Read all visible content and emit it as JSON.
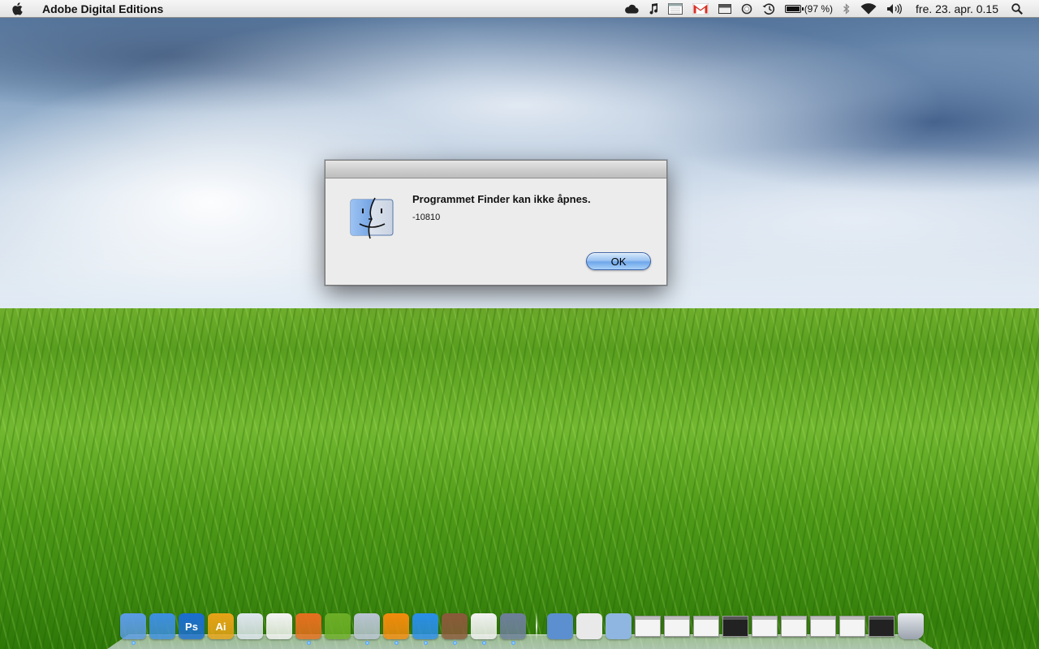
{
  "menubar": {
    "app_name": "Adobe Digital Editions",
    "battery_label": "(97 %)",
    "battery_level_percent": 97,
    "clock": "fre. 23. apr.  0.15",
    "status_icons": [
      "cloud-icon",
      "music-note-icon",
      "calendar-icon",
      "gmail-icon",
      "menu-extra-icon",
      "sync-icon",
      "time-machine-icon",
      "battery-icon",
      "bluetooth-icon",
      "wifi-icon",
      "volume-icon",
      "spotlight-icon"
    ]
  },
  "dialog": {
    "title": "Programmet Finder kan ikke åpnes.",
    "message": "-10810",
    "ok_label": "OK",
    "icon": "finder-icon"
  },
  "dock": {
    "apps": [
      {
        "name": "finder",
        "icon": "finder-icon",
        "color": "#5b9be6",
        "label": "",
        "running": true
      },
      {
        "name": "safari",
        "icon": "safari-icon",
        "color": "#3d8fe0",
        "label": "",
        "running": false
      },
      {
        "name": "photoshop",
        "icon": "photoshop-icon",
        "color": "#1b6ed0",
        "label": "Ps",
        "running": false
      },
      {
        "name": "illustrator",
        "icon": "illustrator-icon",
        "color": "#e8a317",
        "label": "Ai",
        "running": false
      },
      {
        "name": "ical",
        "icon": "calendar-icon",
        "color": "#dfe6ef",
        "label": "",
        "running": false
      },
      {
        "name": "gmail",
        "icon": "gmail-icon",
        "color": "#f4f4f4",
        "label": "",
        "running": false
      },
      {
        "name": "firefox",
        "icon": "firefox-icon",
        "color": "#e66f1e",
        "label": "",
        "running": true
      },
      {
        "name": "spotify",
        "icon": "spotify-icon",
        "color": "#6cae26",
        "label": "",
        "running": false
      },
      {
        "name": "itunes",
        "icon": "itunes-icon",
        "color": "#b9c4d2",
        "label": "",
        "running": true
      },
      {
        "name": "vlc",
        "icon": "vlc-icon",
        "color": "#f28b0c",
        "label": "",
        "running": true
      },
      {
        "name": "quicktime",
        "icon": "quicktime-icon",
        "color": "#2a8ee8",
        "label": "",
        "running": true
      },
      {
        "name": "digital-editions",
        "icon": "book-icon",
        "color": "#8a5a3a",
        "label": "",
        "running": true
      },
      {
        "name": "preview-red",
        "icon": "preview-icon",
        "color": "#f2f2f2",
        "label": "",
        "running": true
      },
      {
        "name": "iphoto",
        "icon": "photos-icon",
        "color": "#6d7f99",
        "label": "",
        "running": true
      }
    ],
    "docs": [
      {
        "name": "user",
        "icon": "user-folder-icon",
        "color": "#5b8fcf"
      },
      {
        "name": "document",
        "icon": "document-icon",
        "color": "#e9e9e9"
      },
      {
        "name": "folder",
        "icon": "folder-icon",
        "color": "#8fb6e0"
      }
    ],
    "windows": [
      {
        "name": "window-1",
        "icon": "window-thumbnail-icon",
        "dark": false
      },
      {
        "name": "window-2",
        "icon": "window-thumbnail-icon",
        "dark": false
      },
      {
        "name": "window-3",
        "icon": "window-thumbnail-icon",
        "dark": false
      },
      {
        "name": "window-4",
        "icon": "window-thumbnail-icon",
        "dark": true
      },
      {
        "name": "window-5",
        "icon": "window-thumbnail-icon",
        "dark": false
      },
      {
        "name": "window-6",
        "icon": "window-thumbnail-icon",
        "dark": false
      },
      {
        "name": "window-7",
        "icon": "window-thumbnail-icon",
        "dark": false
      },
      {
        "name": "window-8",
        "icon": "window-thumbnail-icon",
        "dark": false
      },
      {
        "name": "window-9",
        "icon": "window-thumbnail-icon",
        "dark": true
      }
    ],
    "trash": {
      "name": "trash",
      "icon": "trash-icon"
    }
  },
  "colors": {
    "menubar_bg": "#e8e8e8",
    "dialog_bg": "#ececec",
    "button_accent": "#6fa7ea",
    "grass": "#5a9e1f",
    "sky": "#8aa7c6"
  }
}
